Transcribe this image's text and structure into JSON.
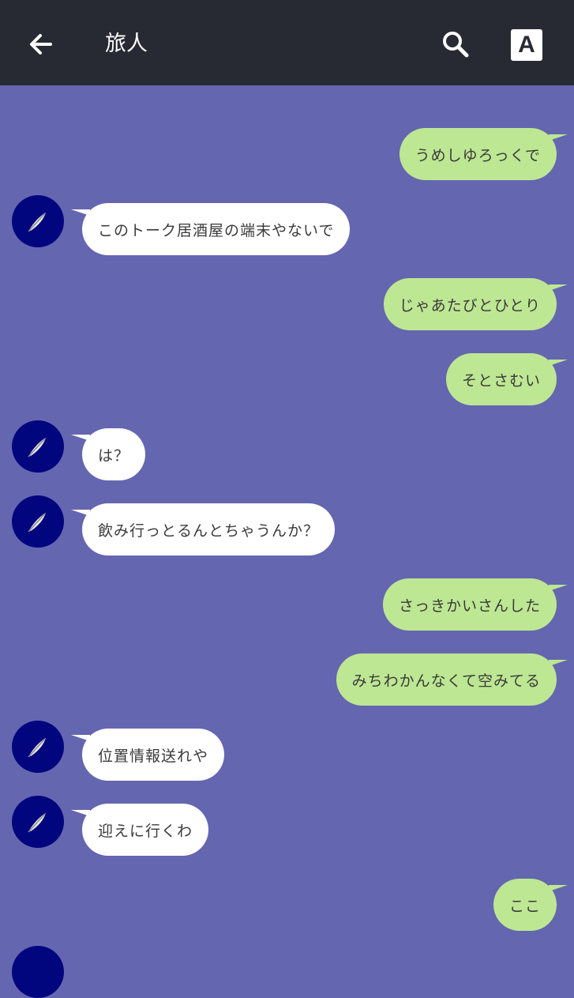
{
  "header": {
    "title": "旅人",
    "back_icon": "arrow-left-icon",
    "search_icon": "search-icon",
    "font_size_label": "A"
  },
  "colors": {
    "header_bg": "#282a33",
    "chat_bg": "#6566b0",
    "sent_bubble": "#bde793",
    "received_bubble": "#ffffff",
    "avatar_bg": "#02067e"
  },
  "messages": [
    {
      "side": "sent",
      "text": "うめしゆろっくで"
    },
    {
      "side": "received",
      "text": "このトーク居酒屋の端末やないで"
    },
    {
      "side": "sent",
      "text": "じゃあたびとひとり"
    },
    {
      "side": "sent",
      "text": "そとさむい"
    },
    {
      "side": "received",
      "text": "は？"
    },
    {
      "side": "received",
      "text": "飲み行っとるんとちゃうんか？"
    },
    {
      "side": "sent",
      "text": "さっきかいさんした"
    },
    {
      "side": "sent",
      "text": "みちわかんなくて空みてる"
    },
    {
      "side": "received",
      "text": "位置情報送れや"
    },
    {
      "side": "received",
      "text": "迎えに行くわ"
    },
    {
      "side": "sent",
      "text": "ここ"
    }
  ]
}
